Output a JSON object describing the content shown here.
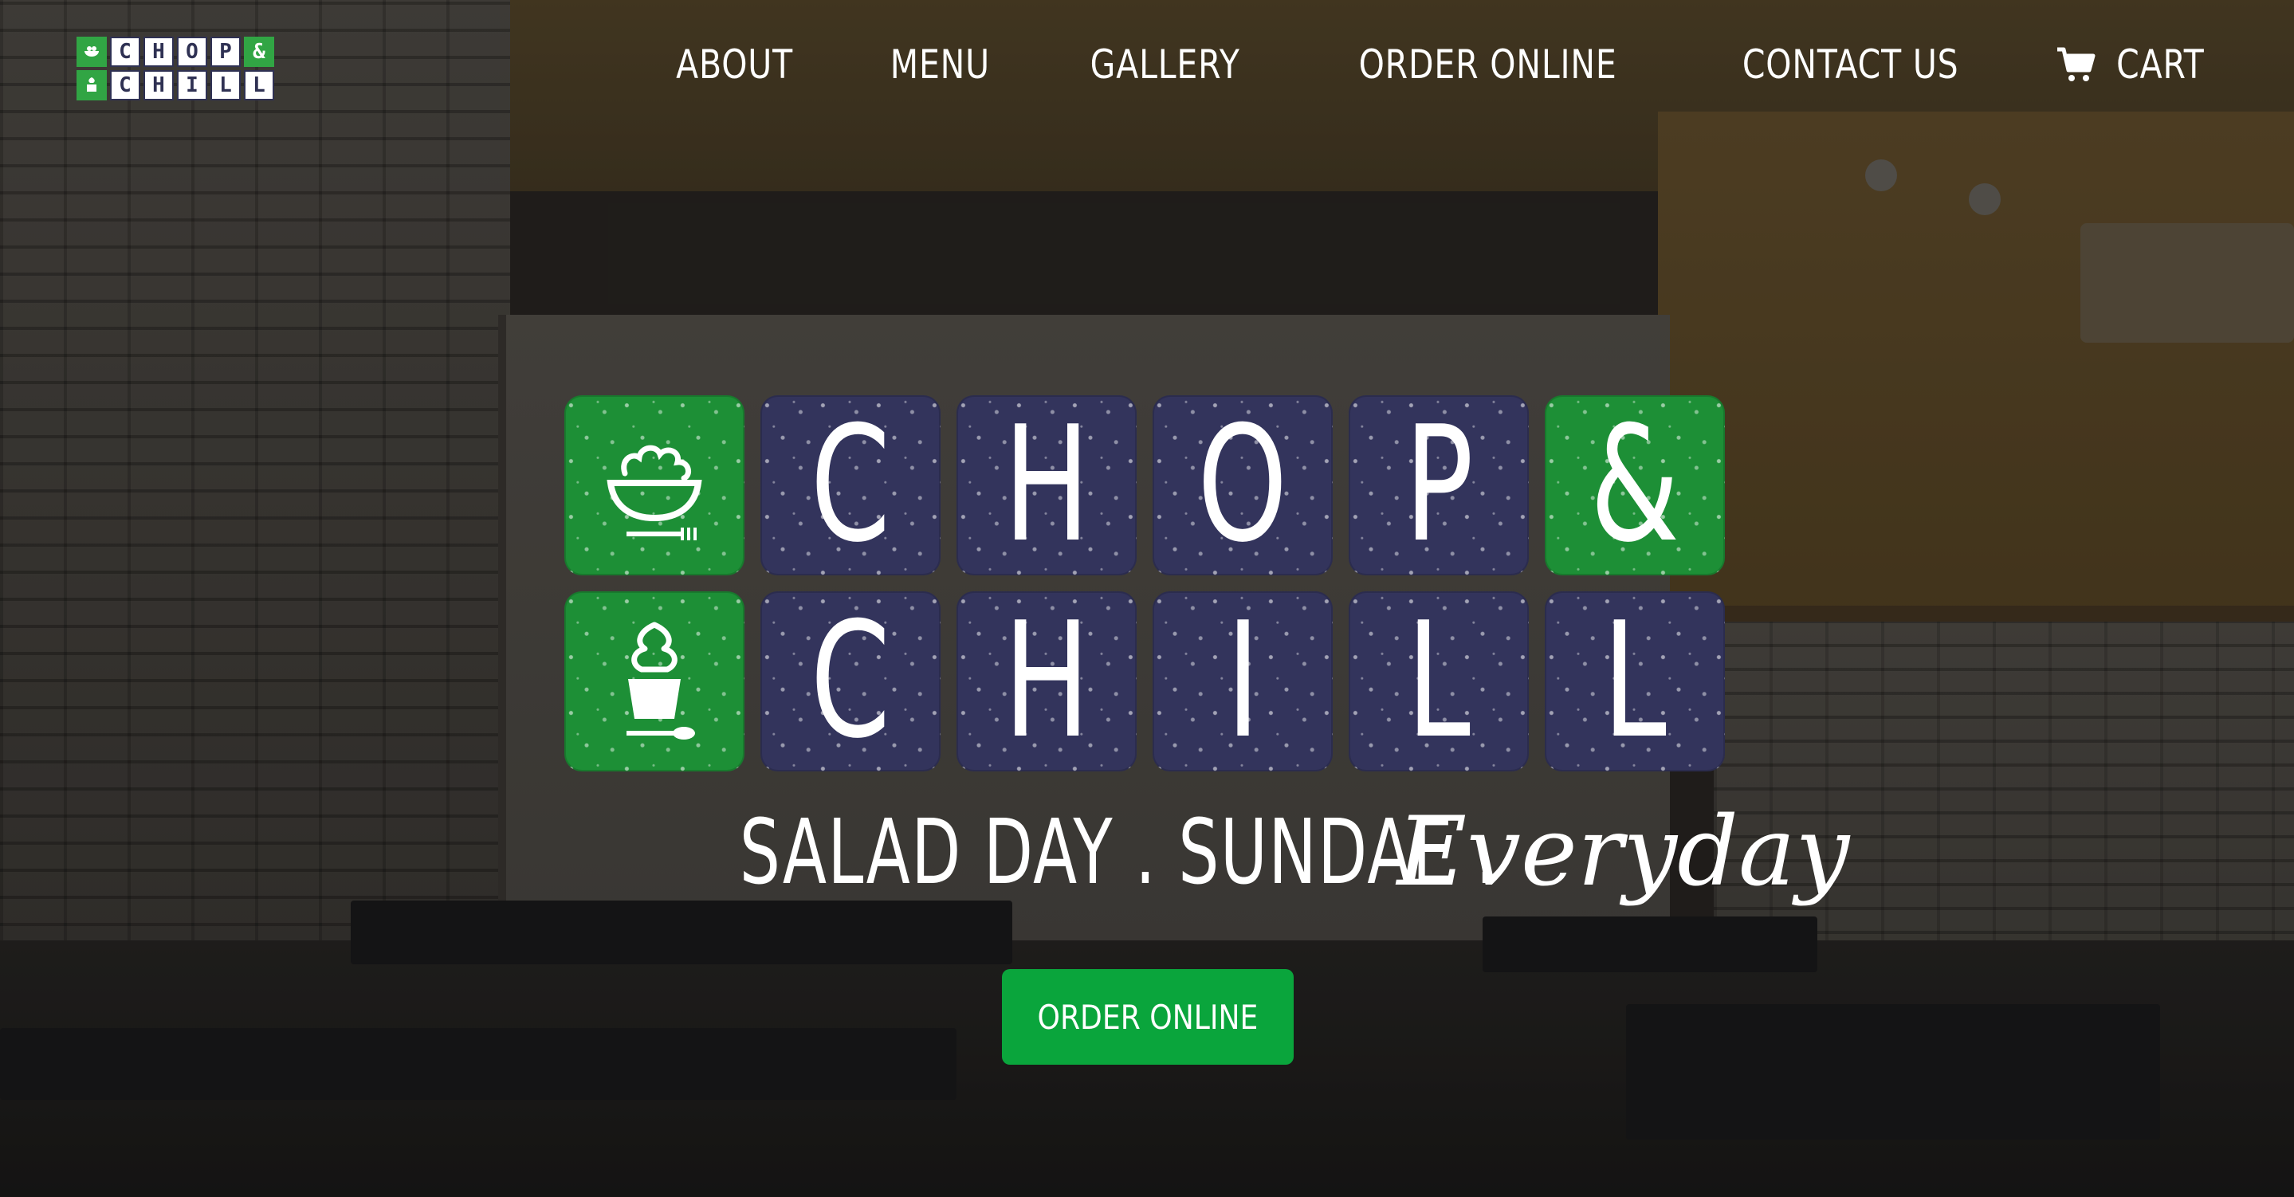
{
  "brand": {
    "top_row": [
      "C",
      "H",
      "O",
      "P",
      "&"
    ],
    "bottom_row": [
      "C",
      "H",
      "I",
      "L",
      "L"
    ],
    "colors": {
      "navy": "#33345c",
      "green": "#1d8f36",
      "button": "#0aa53c"
    }
  },
  "nav": {
    "items": [
      "ABOUT",
      "MENU",
      "GALLERY",
      "ORDER ONLINE",
      "CONTACT US"
    ],
    "cart_label": "CART",
    "cart_icon": "shopping-cart-icon"
  },
  "hero": {
    "tagline_main": "SALAD DAY . SUNDAE .",
    "tagline_script": "Everyday",
    "cta_label": "ORDER ONLINE",
    "icons": [
      "salad-bowl-icon",
      "frozen-yogurt-icon"
    ]
  }
}
